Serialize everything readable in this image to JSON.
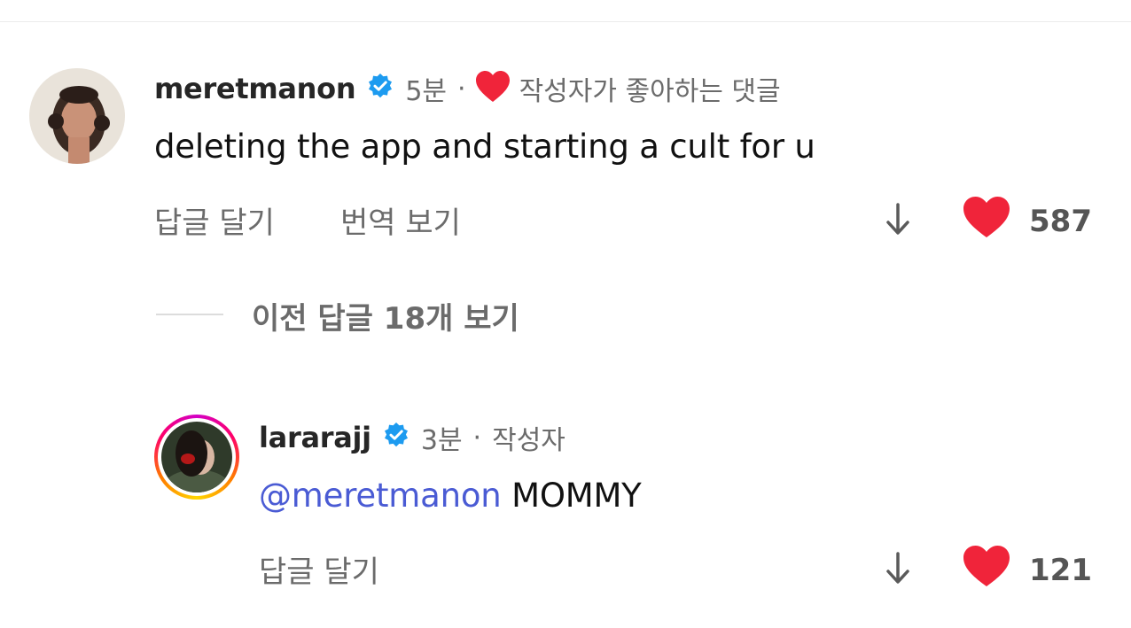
{
  "comment": {
    "username": "meretmanon",
    "time": "5분",
    "separator": "·",
    "creator_liked_label": "작성자가 좋아하는 댓글",
    "text": "deleting the app and starting a cult for u",
    "reply_label": "답글 달기",
    "translate_label": "번역 보기",
    "like_count": "587"
  },
  "thread": {
    "view_replies_label": "이전 답글 18개 보기"
  },
  "reply": {
    "username": "lararajj",
    "time": "3분",
    "separator": "·",
    "author_label": "작성자",
    "mention": "@meretmanon",
    "text": " MOMMY",
    "reply_label": "답글 달기",
    "like_count": "121"
  },
  "colors": {
    "heart": "#f0243a",
    "verified": "#1d9bf0",
    "mention": "#4a5bd4"
  }
}
